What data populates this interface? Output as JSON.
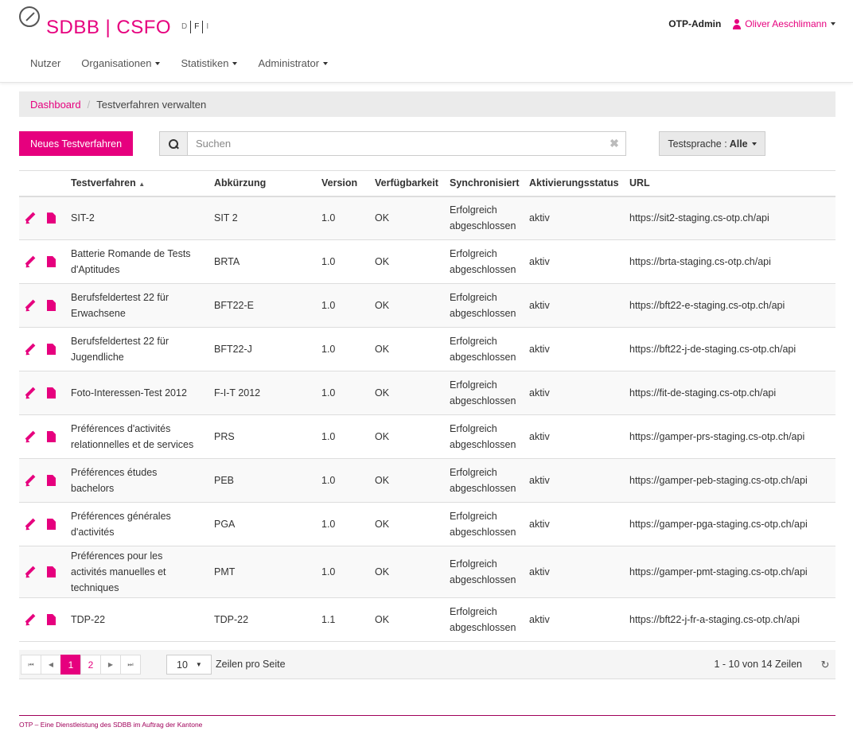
{
  "brand": {
    "logo_text": "SDBB | CSFO",
    "accent": "#e6007e"
  },
  "languages": [
    "D",
    "F",
    "I"
  ],
  "top_right": {
    "admin_label": "OTP-Admin",
    "user_name": "Oliver Aeschlimann"
  },
  "nav": [
    "Nutzer",
    "Organisationen",
    "Statistiken",
    "Administrator"
  ],
  "breadcrumb": {
    "link": "Dashboard",
    "current": "Testverfahren verwalten"
  },
  "toolbar": {
    "new_button": "Neues Testverfahren",
    "search_placeholder": "Suchen",
    "lang_filter_label": "Testsprache :",
    "lang_filter_value": "Alle"
  },
  "table": {
    "headers": [
      "Testverfahren",
      "Abkürzung",
      "Version",
      "Verfügbarkeit",
      "Synchronisiert",
      "Aktivierungsstatus",
      "URL"
    ],
    "rows": [
      {
        "name": [
          "SIT-2"
        ],
        "abbr": "SIT 2",
        "version": "1.0",
        "avail": "OK",
        "sync": [
          "Erfolgreich",
          "abgeschlossen"
        ],
        "status": "aktiv",
        "url": "https://sit2-staging.cs-otp.ch/api"
      },
      {
        "name": [
          "Batterie Romande de Tests",
          "d'Aptitudes"
        ],
        "abbr": "BRTA",
        "version": "1.0",
        "avail": "OK",
        "sync": [
          "Erfolgreich",
          "abgeschlossen"
        ],
        "status": "aktiv",
        "url": "https://brta-staging.cs-otp.ch/api"
      },
      {
        "name": [
          "Berufsfeldertest 22 für",
          "Erwachsene"
        ],
        "abbr": "BFT22-E",
        "version": "1.0",
        "avail": "OK",
        "sync": [
          "Erfolgreich",
          "abgeschlossen"
        ],
        "status": "aktiv",
        "url": "https://bft22-e-staging.cs-otp.ch/api"
      },
      {
        "name": [
          "Berufsfeldertest 22 für",
          "Jugendliche"
        ],
        "abbr": "BFT22-J",
        "version": "1.0",
        "avail": "OK",
        "sync": [
          "Erfolgreich",
          "abgeschlossen"
        ],
        "status": "aktiv",
        "url": "https://bft22-j-de-staging.cs-otp.ch/api"
      },
      {
        "name": [
          "Foto-Interessen-Test 2012"
        ],
        "abbr": "F-I-T 2012",
        "version": "1.0",
        "avail": "OK",
        "sync": [
          "Erfolgreich",
          "abgeschlossen"
        ],
        "status": "aktiv",
        "url": "https://fit-de-staging.cs-otp.ch/api"
      },
      {
        "name": [
          "Préférences d'activités",
          "relationnelles et de services"
        ],
        "abbr": "PRS",
        "version": "1.0",
        "avail": "OK",
        "sync": [
          "Erfolgreich",
          "abgeschlossen"
        ],
        "status": "aktiv",
        "url": "https://gamper-prs-staging.cs-otp.ch/api"
      },
      {
        "name": [
          "Préférences études",
          "bachelors"
        ],
        "abbr": "PEB",
        "version": "1.0",
        "avail": "OK",
        "sync": [
          "Erfolgreich",
          "abgeschlossen"
        ],
        "status": "aktiv",
        "url": "https://gamper-peb-staging.cs-otp.ch/api"
      },
      {
        "name": [
          "Préférences générales",
          "d'activités"
        ],
        "abbr": "PGA",
        "version": "1.0",
        "avail": "OK",
        "sync": [
          "Erfolgreich",
          "abgeschlossen"
        ],
        "status": "aktiv",
        "url": "https://gamper-pga-staging.cs-otp.ch/api"
      },
      {
        "name": [
          "Préférences pour les",
          "activités manuelles et",
          "techniques"
        ],
        "abbr": "PMT",
        "version": "1.0",
        "avail": "OK",
        "sync": [
          "Erfolgreich",
          "abgeschlossen"
        ],
        "status": "aktiv",
        "url": "https://gamper-pmt-staging.cs-otp.ch/api"
      },
      {
        "name": [
          "TDP-22"
        ],
        "abbr": "TDP-22",
        "version": "1.1",
        "avail": "OK",
        "sync": [
          "Erfolgreich",
          "abgeschlossen"
        ],
        "status": "aktiv",
        "url": "https://bft22-j-fr-a-staging.cs-otp.ch/api"
      }
    ]
  },
  "pagination": {
    "pages": [
      "1",
      "2"
    ],
    "active_page": "1",
    "per_page": "10",
    "per_page_label": "Zeilen pro Seite",
    "count_label": "1 - 10 von 14 Zeilen"
  },
  "footer": {
    "text": "OTP – Eine Dienstleistung des SDBB im Auftrag der Kantone"
  }
}
